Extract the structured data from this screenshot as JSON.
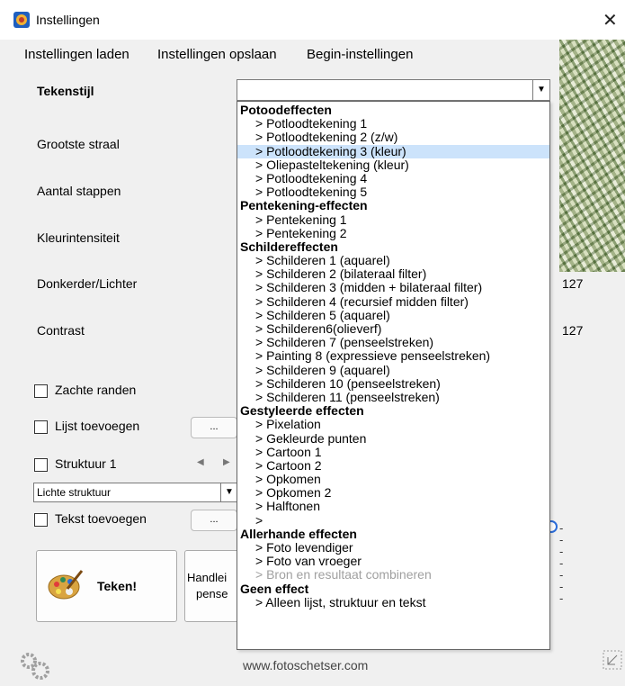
{
  "window": {
    "title": "Instellingen",
    "close_glyph": "✕"
  },
  "menu": [
    "Instellingen laden",
    "Instellingen opslaan",
    "Begin-instellingen"
  ],
  "settings": {
    "style_label": "Tekenstijl",
    "radius_label": "Grootste straal",
    "steps_label": "Aantal stappen",
    "color_label": "Kleurintensiteit",
    "brightness_label": "Donkerder/Lichter",
    "brightness_value": "127",
    "contrast_label": "Contrast",
    "contrast_value": "127",
    "soft_edges_label": "Zachte randen",
    "frame_label": "Lijst toevoegen",
    "frame_button": "...",
    "structure_label": "Struktuur 1",
    "structure_select": "Lichte struktuur",
    "text_label": "Tekst toevoegen",
    "text_button": "..."
  },
  "buttons": {
    "draw_label": "Teken!",
    "manual_line1": "Handlei",
    "manual_line2": "pense"
  },
  "footer": {
    "website": "www.fotoschetser.com"
  },
  "dropdown": {
    "selected": "Potloodtekening 3 (kleur)",
    "rows": [
      {
        "type": "group",
        "label": "Potoodeffecten"
      },
      {
        "type": "item",
        "label": ">  Potloodtekening 1"
      },
      {
        "type": "item",
        "label": ">  Potloodtekening 2 (z/w)"
      },
      {
        "type": "item",
        "label": ">  Potloodtekening 3 (kleur)",
        "selected": true
      },
      {
        "type": "item",
        "label": ">  Oliepasteltekening (kleur)"
      },
      {
        "type": "item",
        "label": ">  Potloodtekening 4"
      },
      {
        "type": "item",
        "label": ">  Potloodtekening 5"
      },
      {
        "type": "group",
        "label": "Pentekening-effecten"
      },
      {
        "type": "item",
        "label": ">  Pentekening 1"
      },
      {
        "type": "item",
        "label": ">  Pentekening 2"
      },
      {
        "type": "group",
        "label": "Schildereffecten"
      },
      {
        "type": "item",
        "label": ">  Schilderen 1 (aquarel)"
      },
      {
        "type": "item",
        "label": ">  Schilderen 2 (bilateraal filter)"
      },
      {
        "type": "item",
        "label": ">  Schilderen 3 (midden + bilateraal filter)"
      },
      {
        "type": "item",
        "label": ">  Schilderen 4 (recursief midden filter)"
      },
      {
        "type": "item",
        "label": ">  Schilderen 5 (aquarel)"
      },
      {
        "type": "item",
        "label": ">  Schilderen6(olieverf)"
      },
      {
        "type": "item",
        "label": ">  Schilderen 7 (penseelstreken)"
      },
      {
        "type": "item",
        "label": ">  Painting 8 (expressieve penseelstreken)"
      },
      {
        "type": "item",
        "label": ">  Schilderen 9 (aquarel)"
      },
      {
        "type": "item",
        "label": ">  Schilderen 10 (penseelstreken)"
      },
      {
        "type": "item",
        "label": ">  Schilderen 11 (penseelstreken)"
      },
      {
        "type": "group",
        "label": "Gestyleerde effecten"
      },
      {
        "type": "item",
        "label": ">  Pixelation"
      },
      {
        "type": "item",
        "label": ">  Gekleurde punten"
      },
      {
        "type": "item",
        "label": ">  Cartoon 1"
      },
      {
        "type": "item",
        "label": ">  Cartoon 2"
      },
      {
        "type": "item",
        "label": ">  Opkomen"
      },
      {
        "type": "item",
        "label": ">  Opkomen 2"
      },
      {
        "type": "item",
        "label": ">  Halftonen"
      },
      {
        "type": "item",
        "label": ">"
      },
      {
        "type": "group",
        "label": "Allerhande effecten"
      },
      {
        "type": "item",
        "label": ">  Foto levendiger"
      },
      {
        "type": "item",
        "label": ">  Foto van vroeger"
      },
      {
        "type": "item",
        "label": ">  Bron en resultaat combineren",
        "disabled": true
      },
      {
        "type": "group",
        "label": "Geen effect"
      },
      {
        "type": "item",
        "label": ">  Alleen lijst, struktuur en tekst"
      }
    ]
  },
  "colors": {
    "selection": "#cce3fb",
    "background": "#f0f0f0"
  },
  "icons": [
    "app-icon",
    "close-icon",
    "chevron-down-icon",
    "palette-icon",
    "gear-icon",
    "resize-grip-icon"
  ]
}
